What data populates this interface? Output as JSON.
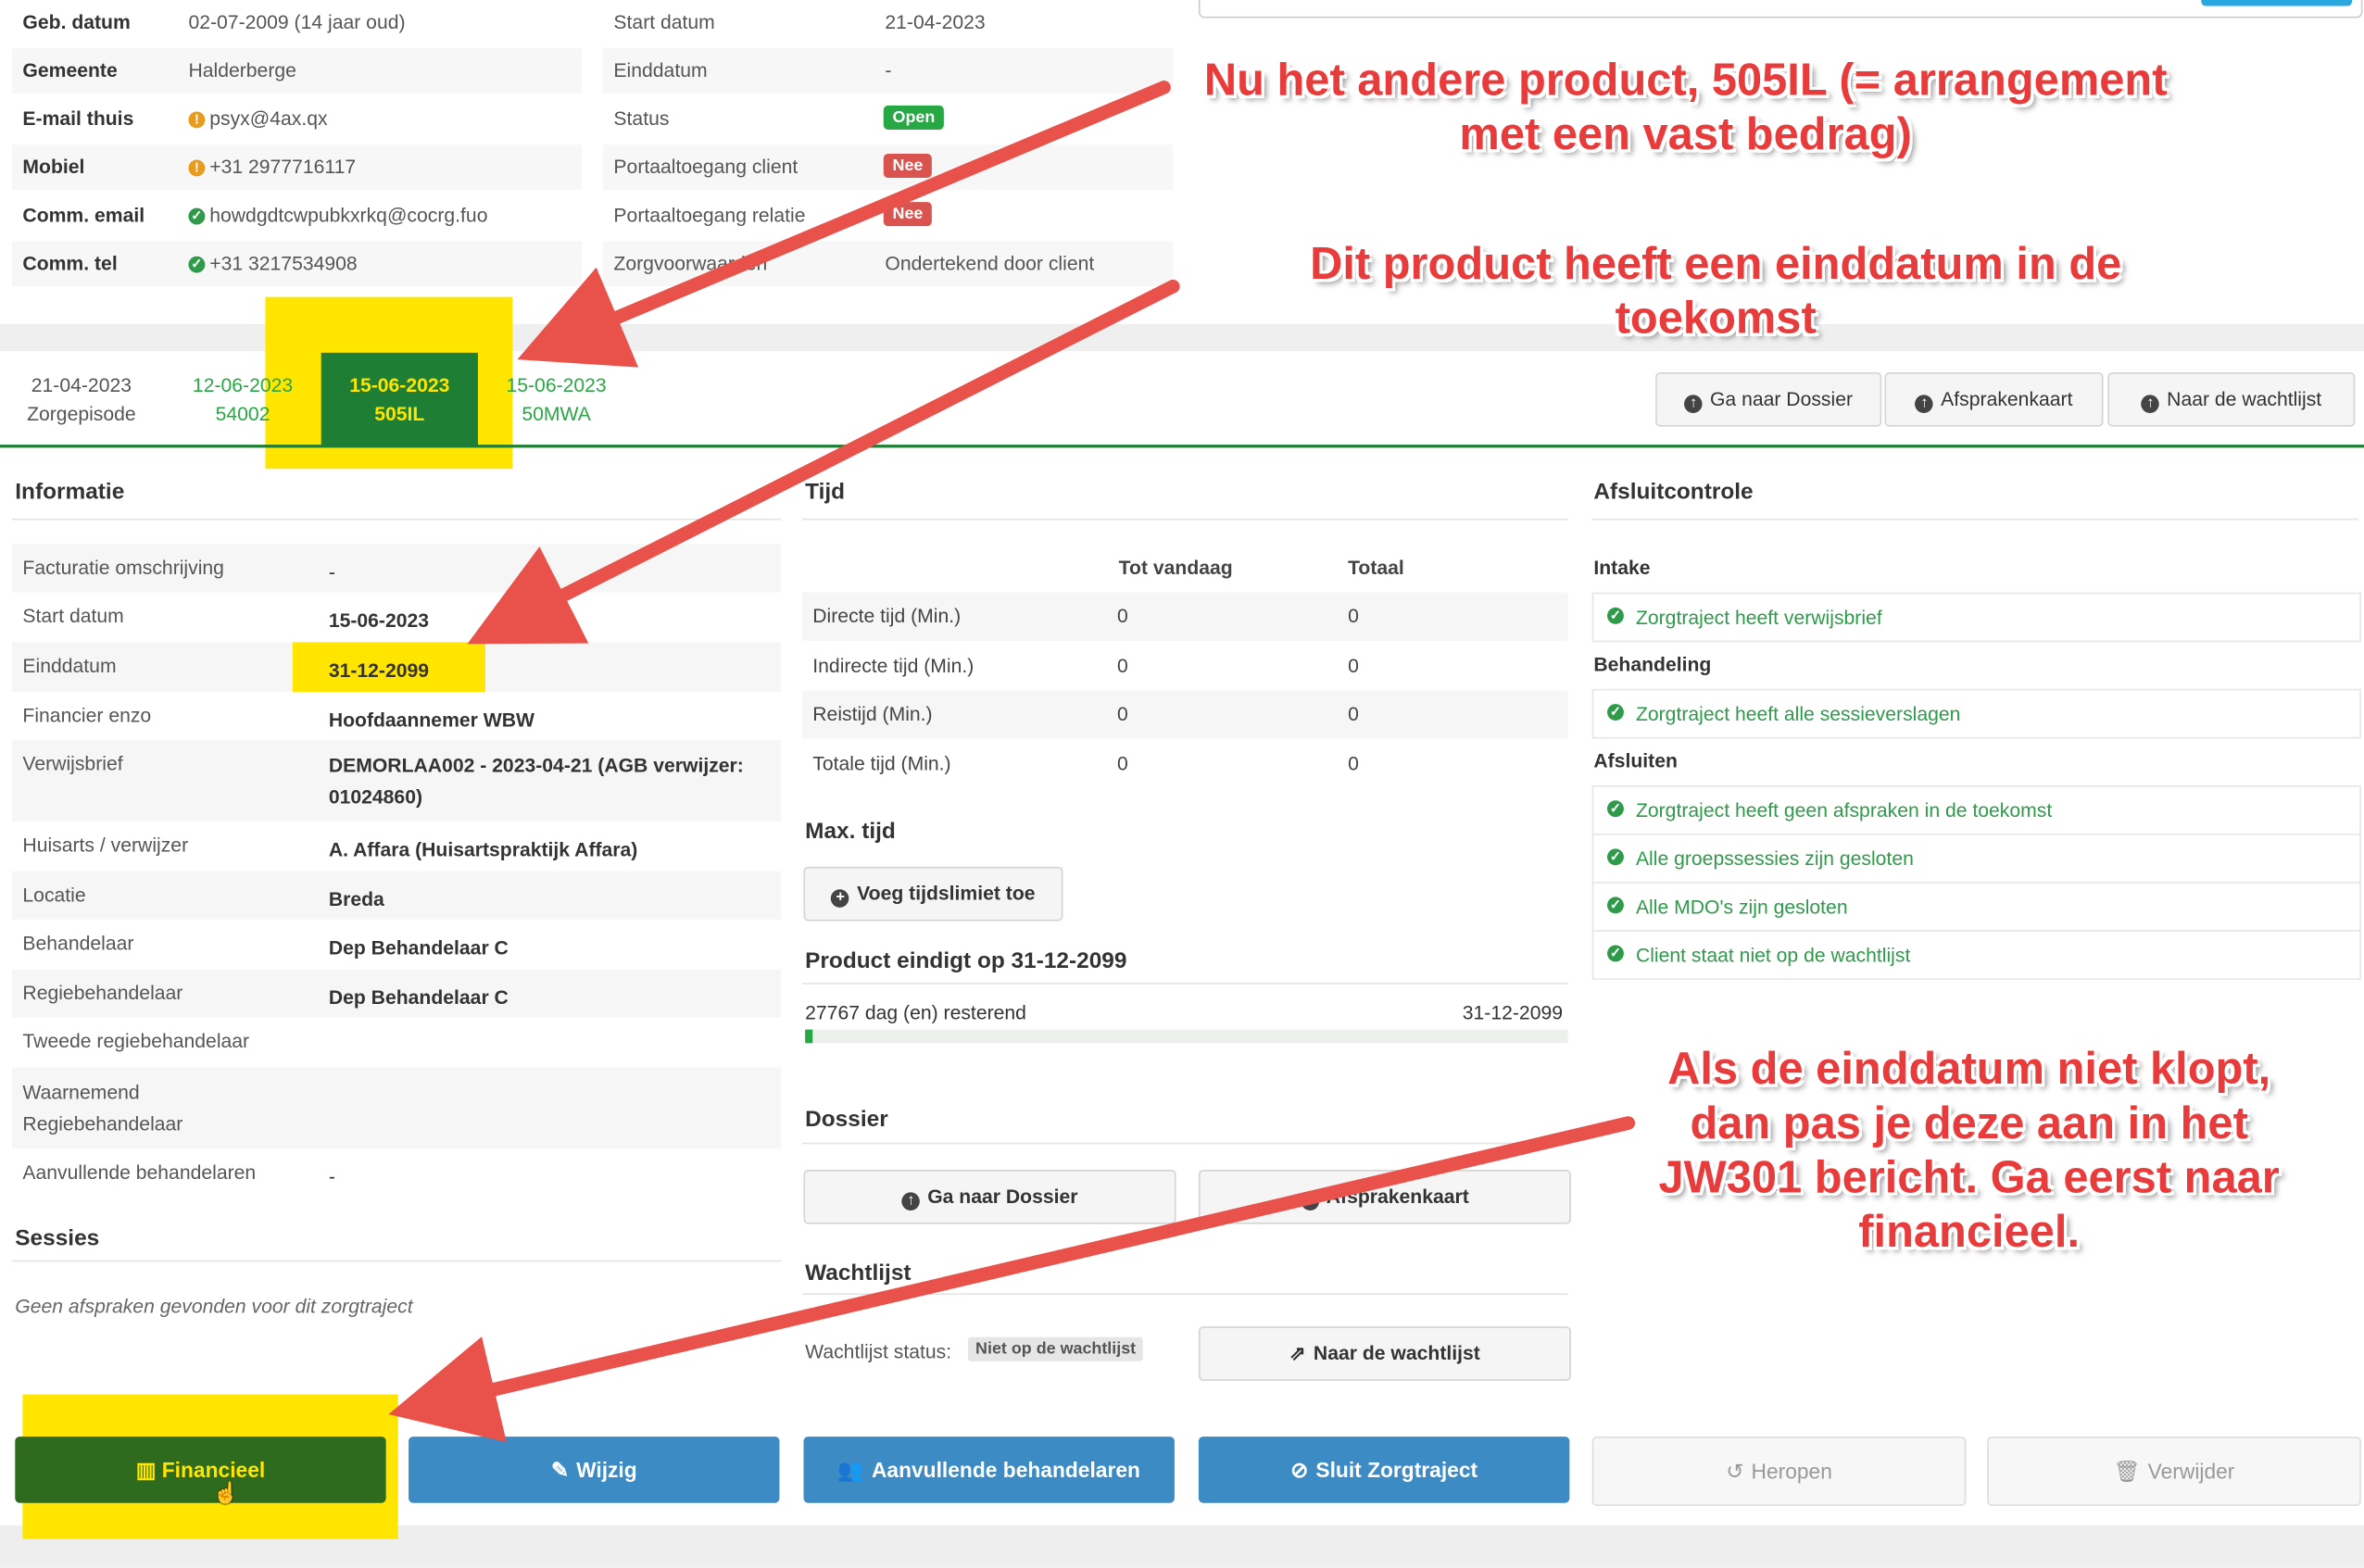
{
  "client": {
    "rows": [
      {
        "label": "Geb. datum",
        "value": "02-07-2009 (14 jaar oud)",
        "icon": ""
      },
      {
        "label": "Gemeente",
        "value": "Halderberge",
        "icon": ""
      },
      {
        "label": "E-mail thuis",
        "value": "psyx@4ax.qx",
        "icon": "warning-icon"
      },
      {
        "label": "Mobiel",
        "value": "+31 2977716117",
        "icon": "warning-icon"
      },
      {
        "label": "Comm. email",
        "value": "howdgdtcwpubkxrkq@cocrg.fuo",
        "icon": "check-icon"
      },
      {
        "label": "Comm. tel",
        "value": "+31 3217534908",
        "icon": "check-icon"
      }
    ],
    "rows2": [
      {
        "label": "Start datum",
        "value": "21-04-2023"
      },
      {
        "label": "Einddatum",
        "value": "-"
      },
      {
        "label": "Status",
        "badge": "Open",
        "badge_color": "#28a745"
      },
      {
        "label": "Portaaltoegang client",
        "badge": "Nee",
        "badge_color": "#d9534f"
      },
      {
        "label": "Portaaltoegang relatie",
        "badge": "Nee",
        "badge_color": "#d9534f"
      },
      {
        "label": "Zorgvoorwaarden",
        "value": "Ondertekend door client"
      }
    ]
  },
  "tabs": [
    {
      "date": "21-04-2023",
      "product": "Zorgepisode"
    },
    {
      "date": "12-06-2023",
      "product": "54002"
    },
    {
      "date": "15-06-2023",
      "product": "505IL"
    },
    {
      "date": "15-06-2023",
      "product": "50MWA"
    }
  ],
  "header_buttons": {
    "dossier": "Ga naar Dossier",
    "afspraken": "Afsprakenkaart",
    "wachtlijst": "Naar de wachtlijst"
  },
  "info": {
    "title": "Informatie",
    "rows": [
      {
        "label": "Facturatie omschrijving",
        "value": "-"
      },
      {
        "label": "Start datum",
        "value": "15-06-2023"
      },
      {
        "label": "Einddatum",
        "value": "31-12-2099"
      },
      {
        "label": "Financier enzo",
        "value": "Hoofdaannemer WBW"
      },
      {
        "label": "Verwijsbrief",
        "value": "DEMORLAA002 - 2023-04-21 (AGB verwijzer: 01024860)"
      },
      {
        "label": "Huisarts / verwijzer",
        "value": "A. Affara (Huisartspraktijk Affara)"
      },
      {
        "label": "Locatie",
        "value": "Breda"
      },
      {
        "label": "Behandelaar",
        "value": "Dep Behandelaar C"
      },
      {
        "label": "Regiebehandelaar",
        "value": "Dep Behandelaar C"
      },
      {
        "label": "Tweede regiebehandelaar",
        "value": ""
      },
      {
        "label": "Waarnemend Regiebehandelaar",
        "value": ""
      },
      {
        "label": "Aanvullende behandelaren",
        "value": "-"
      }
    ]
  },
  "sessies": {
    "title": "Sessies",
    "empty": "Geen afspraken gevonden voor dit zorgtraject"
  },
  "tijd": {
    "title": "Tijd",
    "col1": "Tot vandaag",
    "col2": "Totaal",
    "rows": [
      {
        "label": "Directe tijd (Min.)",
        "v1": "0",
        "v2": "0"
      },
      {
        "label": "Indirecte tijd (Min.)",
        "v1": "0",
        "v2": "0"
      },
      {
        "label": "Reistijd (Min.)",
        "v1": "0",
        "v2": "0"
      },
      {
        "label": "Totale tijd (Min.)",
        "v1": "0",
        "v2": "0"
      }
    ],
    "max_title": "Max. tijd",
    "max_button": "Voeg tijdslimiet toe",
    "product_end_title": "Product eindigt op 31-12-2099",
    "remaining": "27767 dag (en) resterend",
    "end_date": "31-12-2099",
    "progress": 0.01
  },
  "dossier": {
    "title": "Dossier",
    "goto": "Ga naar Dossier",
    "afspraken": "Afsprakenkaart"
  },
  "wachtlijst": {
    "title": "Wachtlijst",
    "status_label": "Wachtlijst status:",
    "status_value": "Niet op de wachtlijst",
    "button": "Naar de wachtlijst"
  },
  "afsluit": {
    "title": "Afsluitcontrole",
    "groups": [
      {
        "title": "Intake",
        "items": [
          "Zorgtraject heeft verwijsbrief"
        ]
      },
      {
        "title": "Behandeling",
        "items": [
          "Zorgtraject heeft alle sessieverslagen"
        ]
      },
      {
        "title": "Afsluiten",
        "items": [
          "Zorgtraject heeft geen afspraken in de toekomst",
          "Alle groepssessies zijn gesloten",
          "Alle MDO's zijn gesloten",
          "Client staat niet op de wachtlijst"
        ]
      }
    ]
  },
  "actions": {
    "financieel": "Financieel",
    "wijzig": "Wijzig",
    "aanvullend": "Aanvullende behandelaren",
    "sluit": "Sluit Zorgtraject",
    "heropen": "Heropen",
    "verwijder": "Verwijder"
  },
  "annotations": {
    "a1_line1": "Nu het andere product, 505IL (= arrangement",
    "a1_line2": "met een vast bedrag)",
    "a2": "Dit product heeft een einddatum in de toekomst",
    "a3_line1": "Als de einddatum niet klopt,",
    "a3_line2": "dan pas je deze aan in het",
    "a3_line3": "JW301 bericht. Ga eerst naar",
    "a3_line4": "financieel."
  },
  "colors": {
    "green_dark": "#1e7e34",
    "green_text": "#28a745",
    "blue": "#3d8bc4",
    "highlight": "#ffe500",
    "annotation_red": "#e83c3c"
  }
}
